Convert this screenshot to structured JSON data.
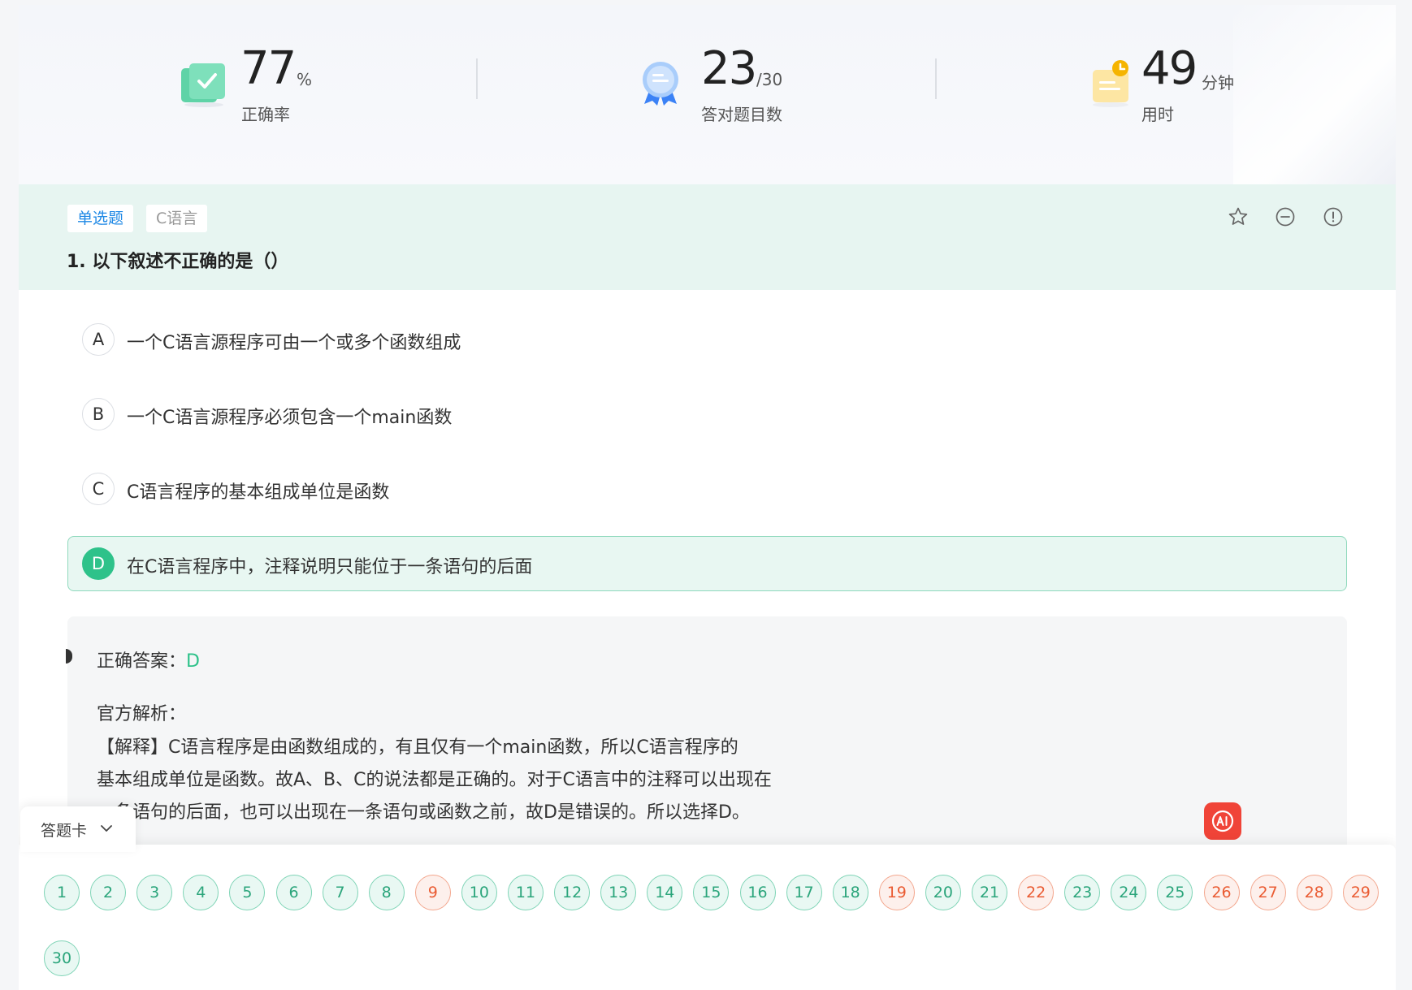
{
  "stats": {
    "accuracy": {
      "value": "77",
      "unit": "%",
      "label": "正确率"
    },
    "correct": {
      "value": "23",
      "unit": "/30",
      "label": "答对题目数"
    },
    "time": {
      "value": "49",
      "unit": "分钟",
      "label": "用时"
    }
  },
  "question": {
    "type_tag": "单选题",
    "subject_tag": "C语言",
    "title": "1. 以下叙述不正确的是（）",
    "actions": [
      "star-icon",
      "minus-circle-icon",
      "exclamation-circle-icon"
    ],
    "options": [
      {
        "letter": "A",
        "text": "一个C语言源程序可由一个或多个函数组成",
        "selected": false
      },
      {
        "letter": "B",
        "text": "一个C语言源程序必须包含一个main函数",
        "selected": false
      },
      {
        "letter": "C",
        "text": "C语言程序的基本组成单位是函数",
        "selected": false
      },
      {
        "letter": "D",
        "text": "在C语言程序中，注释说明只能位于一条语句的后面",
        "selected": true
      }
    ]
  },
  "analysis": {
    "answer_label": "正确答案：",
    "answer_value": "D",
    "explain_label": "官方解析：",
    "lines": [
      "【解释】C语言程序是由函数组成的，有且仅有一个main函数，所以C语言程序的",
      "基本组成单位是函数。故A、B、C的说法都是正确的。对于C语言中的注释可以出现在",
      "一条语句的后面，也可以出现在一条语句或函数之前，故D是错误的。所以选择D。"
    ]
  },
  "answer_card": {
    "label": "答题卡",
    "numbers": [
      {
        "n": "1",
        "status": "correct"
      },
      {
        "n": "2",
        "status": "correct"
      },
      {
        "n": "3",
        "status": "correct"
      },
      {
        "n": "4",
        "status": "correct"
      },
      {
        "n": "5",
        "status": "correct"
      },
      {
        "n": "6",
        "status": "correct"
      },
      {
        "n": "7",
        "status": "correct"
      },
      {
        "n": "8",
        "status": "correct"
      },
      {
        "n": "9",
        "status": "wrong"
      },
      {
        "n": "10",
        "status": "correct"
      },
      {
        "n": "11",
        "status": "correct"
      },
      {
        "n": "12",
        "status": "correct"
      },
      {
        "n": "13",
        "status": "correct"
      },
      {
        "n": "14",
        "status": "correct"
      },
      {
        "n": "15",
        "status": "correct"
      },
      {
        "n": "16",
        "status": "correct"
      },
      {
        "n": "17",
        "status": "correct"
      },
      {
        "n": "18",
        "status": "correct"
      },
      {
        "n": "19",
        "status": "wrong"
      },
      {
        "n": "20",
        "status": "correct"
      },
      {
        "n": "21",
        "status": "correct"
      },
      {
        "n": "22",
        "status": "wrong"
      },
      {
        "n": "23",
        "status": "correct"
      },
      {
        "n": "24",
        "status": "correct"
      },
      {
        "n": "25",
        "status": "correct"
      },
      {
        "n": "26",
        "status": "wrong"
      },
      {
        "n": "27",
        "status": "wrong"
      },
      {
        "n": "28",
        "status": "wrong"
      },
      {
        "n": "29",
        "status": "wrong"
      },
      {
        "n": "30",
        "status": "correct"
      }
    ]
  },
  "colors": {
    "correct": "#2ec28a",
    "wrong": "#ea5c33",
    "header_bg": "#e7f5f1",
    "ai": "#f04438"
  },
  "ai_button": {
    "icon": "ai-icon"
  }
}
